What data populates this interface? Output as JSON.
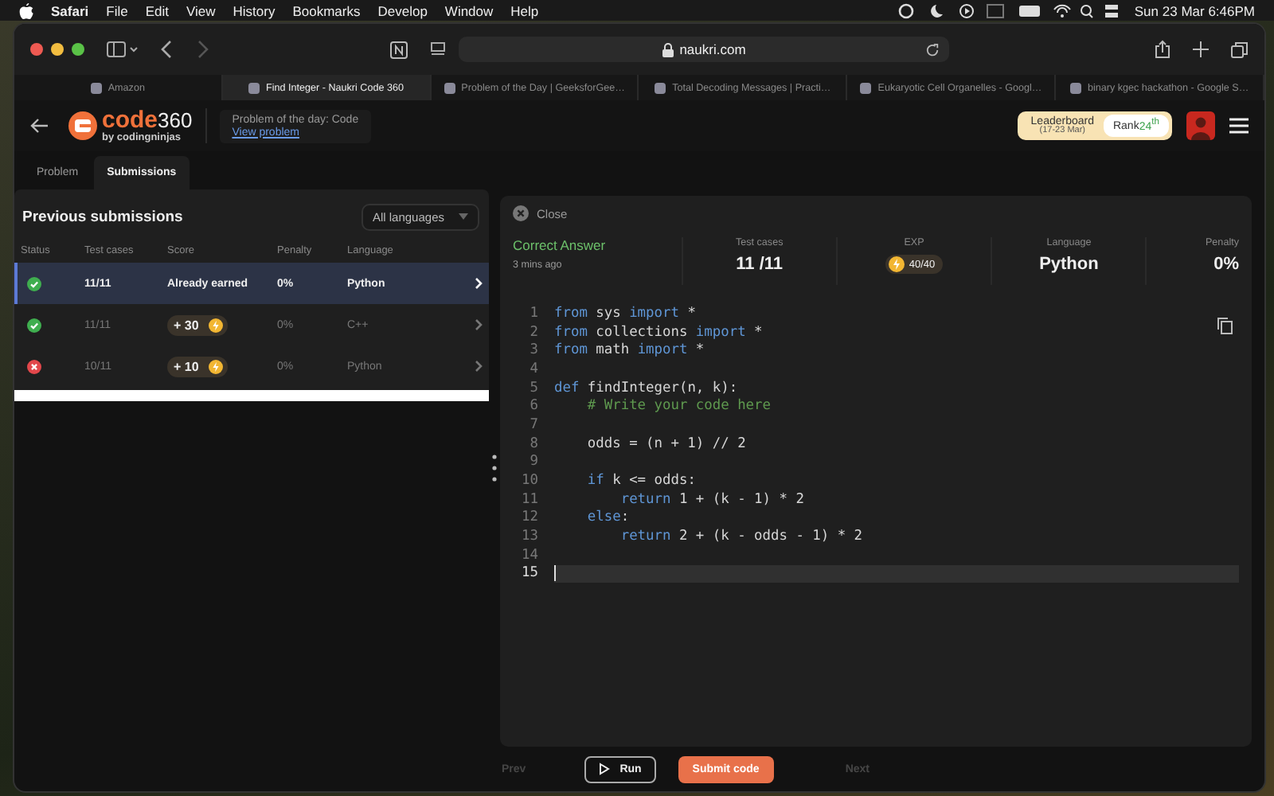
{
  "menu_bar": {
    "app": "Safari",
    "items": [
      "File",
      "Edit",
      "View",
      "History",
      "Bookmarks",
      "Develop",
      "Window",
      "Help"
    ],
    "clock": "Sun 23 Mar  6:46PM"
  },
  "browser": {
    "address": "naukri.com",
    "tabs": [
      {
        "label": "Amazon",
        "selected": false
      },
      {
        "label": "Find Integer - Naukri Code 360",
        "selected": true
      },
      {
        "label": "Problem of the Day | GeeksforGee…",
        "selected": false
      },
      {
        "label": "Total Decoding Messages | Practi…",
        "selected": false
      },
      {
        "label": "Eukaryotic Cell Organelles - Googl…",
        "selected": false
      },
      {
        "label": "binary kgec hackathon - Google S…",
        "selected": false
      }
    ]
  },
  "header": {
    "logo": {
      "brand": "code",
      "number": "360",
      "tagline": "by codingninjas"
    },
    "potd": {
      "label": "Problem of the day: Code",
      "link": "View problem"
    },
    "leaderboard": {
      "label": "Leaderboard",
      "dates": "(17-23 Mar)",
      "rank_label": "Rank",
      "rank": "24$^{th}$"
    }
  },
  "panel_tabs": [
    {
      "label": "Problem",
      "selected": false
    },
    {
      "label": "Submissions",
      "selected": true
    }
  ],
  "submissions": {
    "title": "Previous submissions",
    "filter": "All languages",
    "columns": [
      "Status",
      "Test cases",
      "Score",
      "Penalty",
      "Language"
    ],
    "rows": [
      {
        "kind": "pass",
        "tests": "11/11",
        "score": {
          "kind": "text",
          "text": "Already earned"
        },
        "penalty": "0%",
        "language": "Python",
        "selected": true
      },
      {
        "kind": "pass",
        "tests": "11/11",
        "score": {
          "kind": "coins",
          "text": "+ 30"
        },
        "penalty": "0%",
        "language": "C++",
        "selected": false
      },
      {
        "kind": "fail",
        "tests": "10/11",
        "score": {
          "kind": "coins",
          "text": "+ 10"
        },
        "penalty": "0%",
        "language": "Python",
        "selected": false
      }
    ]
  },
  "result": {
    "close": "Close",
    "verdict": "Correct Answer",
    "time": "3 mins ago",
    "stats": [
      {
        "label": "Test cases",
        "kind": "text",
        "value": "11 /11"
      },
      {
        "label": "EXP",
        "kind": "exp",
        "value": "40/40"
      },
      {
        "label": "Language",
        "kind": "text",
        "value": "Python"
      },
      {
        "label": "Penalty",
        "kind": "text",
        "value": "0%"
      }
    ]
  },
  "code": [
    {
      "number": "1",
      "current": false,
      "tokens": [
        {
          "kind": "kw",
          "text": "from"
        },
        {
          "kind": "plain",
          "text": " sys "
        },
        {
          "kind": "kw",
          "text": "import"
        },
        {
          "kind": "plain",
          "text": " *"
        }
      ]
    },
    {
      "number": "2",
      "current": false,
      "tokens": [
        {
          "kind": "kw",
          "text": "from"
        },
        {
          "kind": "plain",
          "text": " collections "
        },
        {
          "kind": "kw",
          "text": "import"
        },
        {
          "kind": "plain",
          "text": " *"
        }
      ]
    },
    {
      "number": "3",
      "current": false,
      "tokens": [
        {
          "kind": "kw",
          "text": "from"
        },
        {
          "kind": "plain",
          "text": " math "
        },
        {
          "kind": "kw",
          "text": "import"
        },
        {
          "kind": "plain",
          "text": " *"
        }
      ]
    },
    {
      "number": "4",
      "current": false
    },
    {
      "number": "5",
      "current": false,
      "tokens": [
        {
          "kind": "kw",
          "text": "def"
        },
        {
          "kind": "plain",
          "text": " findInteger(n, k):"
        }
      ]
    },
    {
      "number": "6",
      "current": false,
      "tokens": [
        {
          "kind": "comment",
          "text": "    # Write your code here"
        }
      ]
    },
    {
      "number": "7",
      "current": false
    },
    {
      "number": "8",
      "current": false,
      "tokens": [
        {
          "kind": "plain",
          "text": "    odds = (n + 1) // 2"
        }
      ]
    },
    {
      "number": "9",
      "current": false
    },
    {
      "number": "10",
      "current": false,
      "tokens": [
        {
          "kind": "kw",
          "text": "    if"
        },
        {
          "kind": "plain",
          "text": " k <= odds:"
        }
      ]
    },
    {
      "number": "11",
      "current": false,
      "tokens": [
        {
          "kind": "kw",
          "text": "        return"
        },
        {
          "kind": "plain",
          "text": " 1 + (k - 1) * 2"
        }
      ]
    },
    {
      "number": "12",
      "current": false,
      "tokens": [
        {
          "kind": "kw",
          "text": "    else"
        },
        {
          "kind": "plain",
          "text": ":"
        }
      ]
    },
    {
      "number": "13",
      "current": false,
      "tokens": [
        {
          "kind": "kw",
          "text": "        return"
        },
        {
          "kind": "plain",
          "text": " 2 + (k - odds - 1) * 2"
        }
      ]
    },
    {
      "number": "14",
      "current": false
    },
    {
      "number": "15",
      "current": true
    }
  ],
  "footer": [
    {
      "label": "Prev",
      "kind": "nav",
      "disabled": true
    },
    {
      "label": "Run",
      "kind": "run",
      "disabled": false
    },
    {
      "label": "Submit code",
      "kind": "submit",
      "disabled": false
    },
    {
      "label": "Next",
      "kind": "nav",
      "disabled": true
    }
  ]
}
